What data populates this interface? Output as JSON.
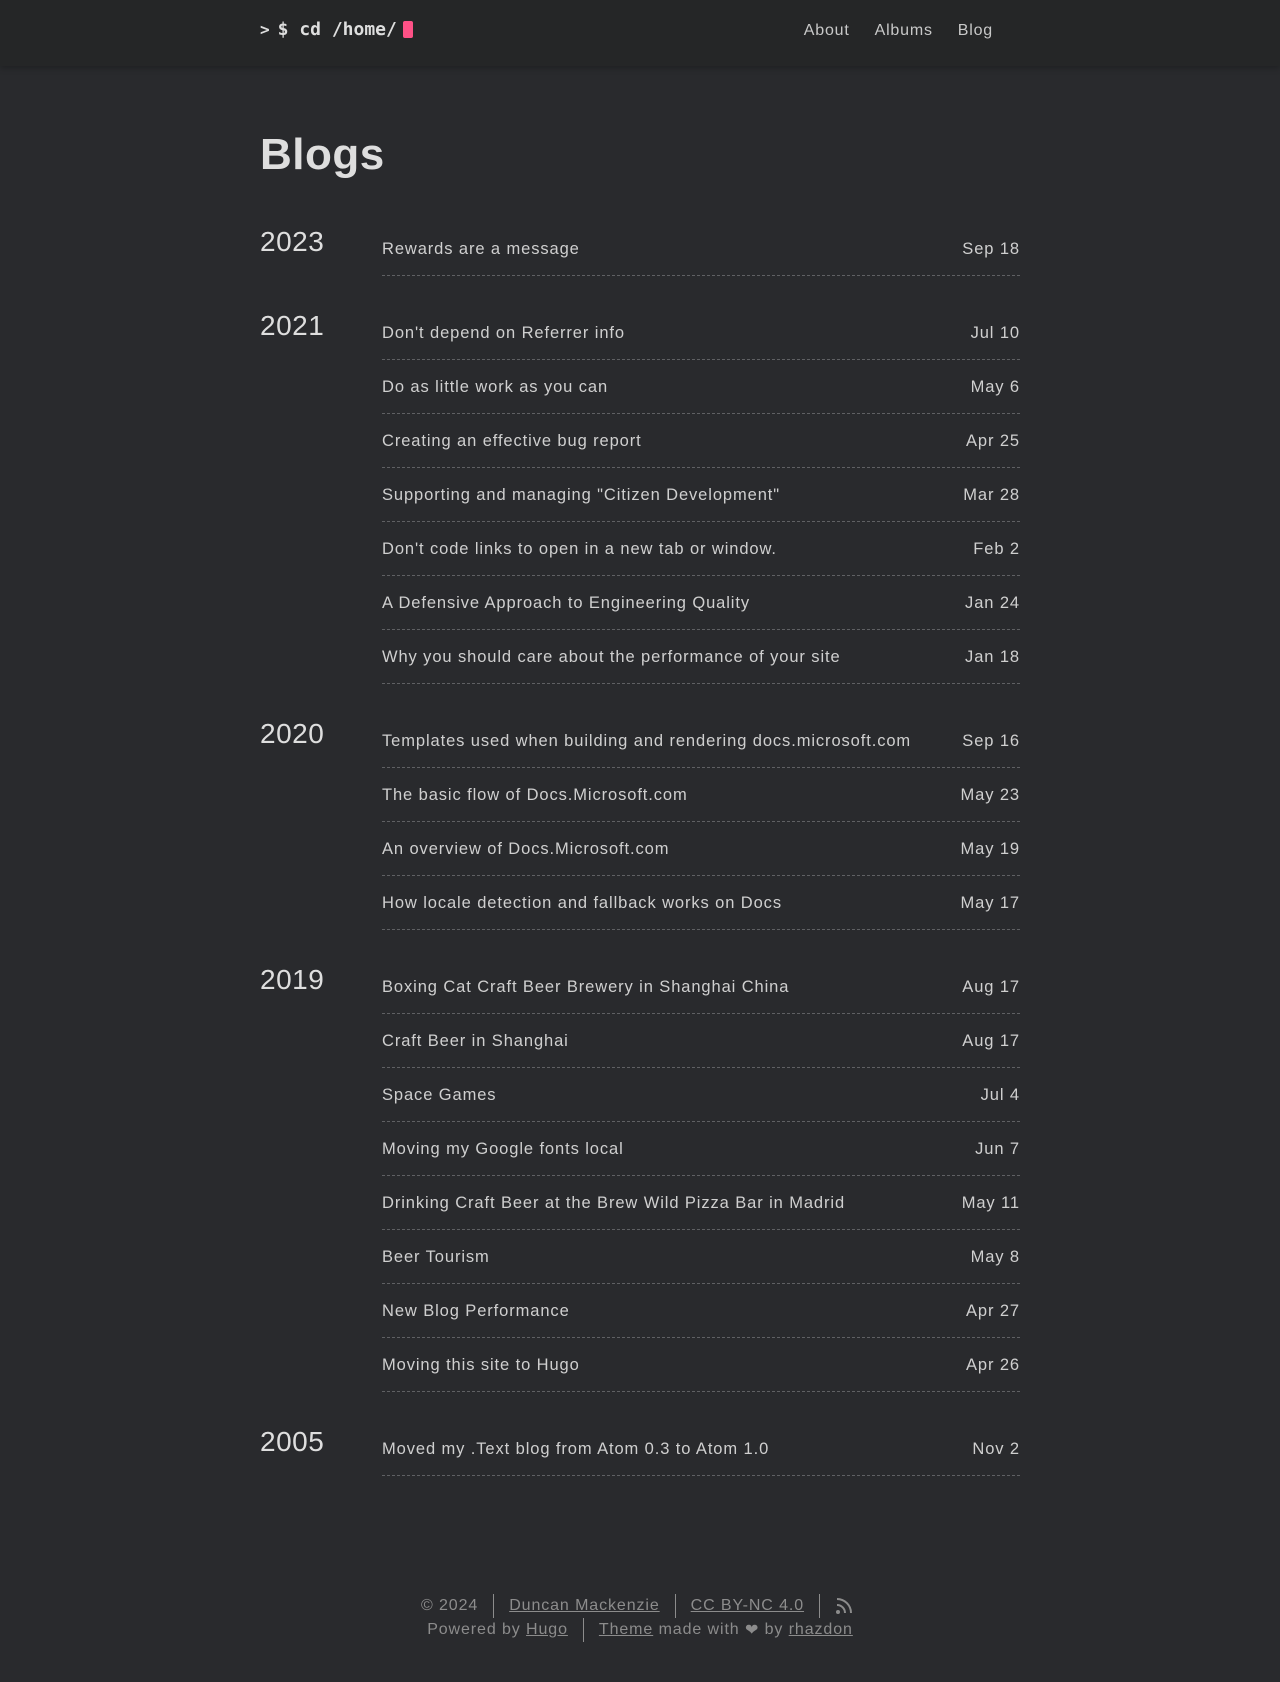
{
  "header": {
    "logo_prompt": ">",
    "logo_text": "$ cd /home/",
    "nav": [
      {
        "label": "About"
      },
      {
        "label": "Albums"
      },
      {
        "label": "Blog"
      }
    ]
  },
  "main": {
    "title": "Blogs",
    "groups": [
      {
        "year": "2023",
        "posts": [
          {
            "title": "Rewards are a message",
            "date": "Sep 18"
          }
        ]
      },
      {
        "year": "2021",
        "posts": [
          {
            "title": "Don't depend on Referrer info",
            "date": "Jul 10"
          },
          {
            "title": "Do as little work as you can",
            "date": "May 6"
          },
          {
            "title": "Creating an effective bug report",
            "date": "Apr 25"
          },
          {
            "title": "Supporting and managing \"Citizen Development\"",
            "date": "Mar 28"
          },
          {
            "title": "Don't code links to open in a new tab or window.",
            "date": "Feb 2"
          },
          {
            "title": "A Defensive Approach to Engineering Quality",
            "date": "Jan 24"
          },
          {
            "title": "Why you should care about the performance of your site",
            "date": "Jan 18"
          }
        ]
      },
      {
        "year": "2020",
        "posts": [
          {
            "title": "Templates used when building and rendering docs.microsoft.com",
            "date": "Sep 16"
          },
          {
            "title": "The basic flow of Docs.Microsoft.com",
            "date": "May 23"
          },
          {
            "title": "An overview of Docs.Microsoft.com",
            "date": "May 19"
          },
          {
            "title": "How locale detection and fallback works on Docs",
            "date": "May 17"
          }
        ]
      },
      {
        "year": "2019",
        "posts": [
          {
            "title": "Boxing Cat Craft Beer Brewery in Shanghai China",
            "date": "Aug 17"
          },
          {
            "title": "Craft Beer in Shanghai",
            "date": "Aug 17"
          },
          {
            "title": "Space Games",
            "date": "Jul 4"
          },
          {
            "title": "Moving my Google fonts local",
            "date": "Jun 7"
          },
          {
            "title": "Drinking Craft Beer at the Brew Wild Pizza Bar in Madrid",
            "date": "May 11"
          },
          {
            "title": "Beer Tourism",
            "date": "May 8"
          },
          {
            "title": "New Blog Performance",
            "date": "Apr 27"
          },
          {
            "title": "Moving this site to Hugo",
            "date": "Apr 26"
          }
        ]
      },
      {
        "year": "2005",
        "posts": [
          {
            "title": "Moved my .Text blog from Atom 0.3 to Atom 1.0",
            "date": "Nov 2"
          }
        ]
      }
    ]
  },
  "footer": {
    "copyright": "© 2024",
    "author": "Duncan Mackenzie",
    "license": "CC BY-NC 4.0",
    "rss_icon": "rss-icon",
    "powered_by": "Powered by",
    "hugo": "Hugo",
    "theme": "Theme",
    "made_with": "made with",
    "heart": "❤",
    "by": "by",
    "theme_author": "rhazdon"
  },
  "colors": {
    "background": "#292a2d",
    "header": "#252627",
    "cursor_accent": "#fe5186",
    "text": "#dadada",
    "muted": "#8c8c8c"
  }
}
